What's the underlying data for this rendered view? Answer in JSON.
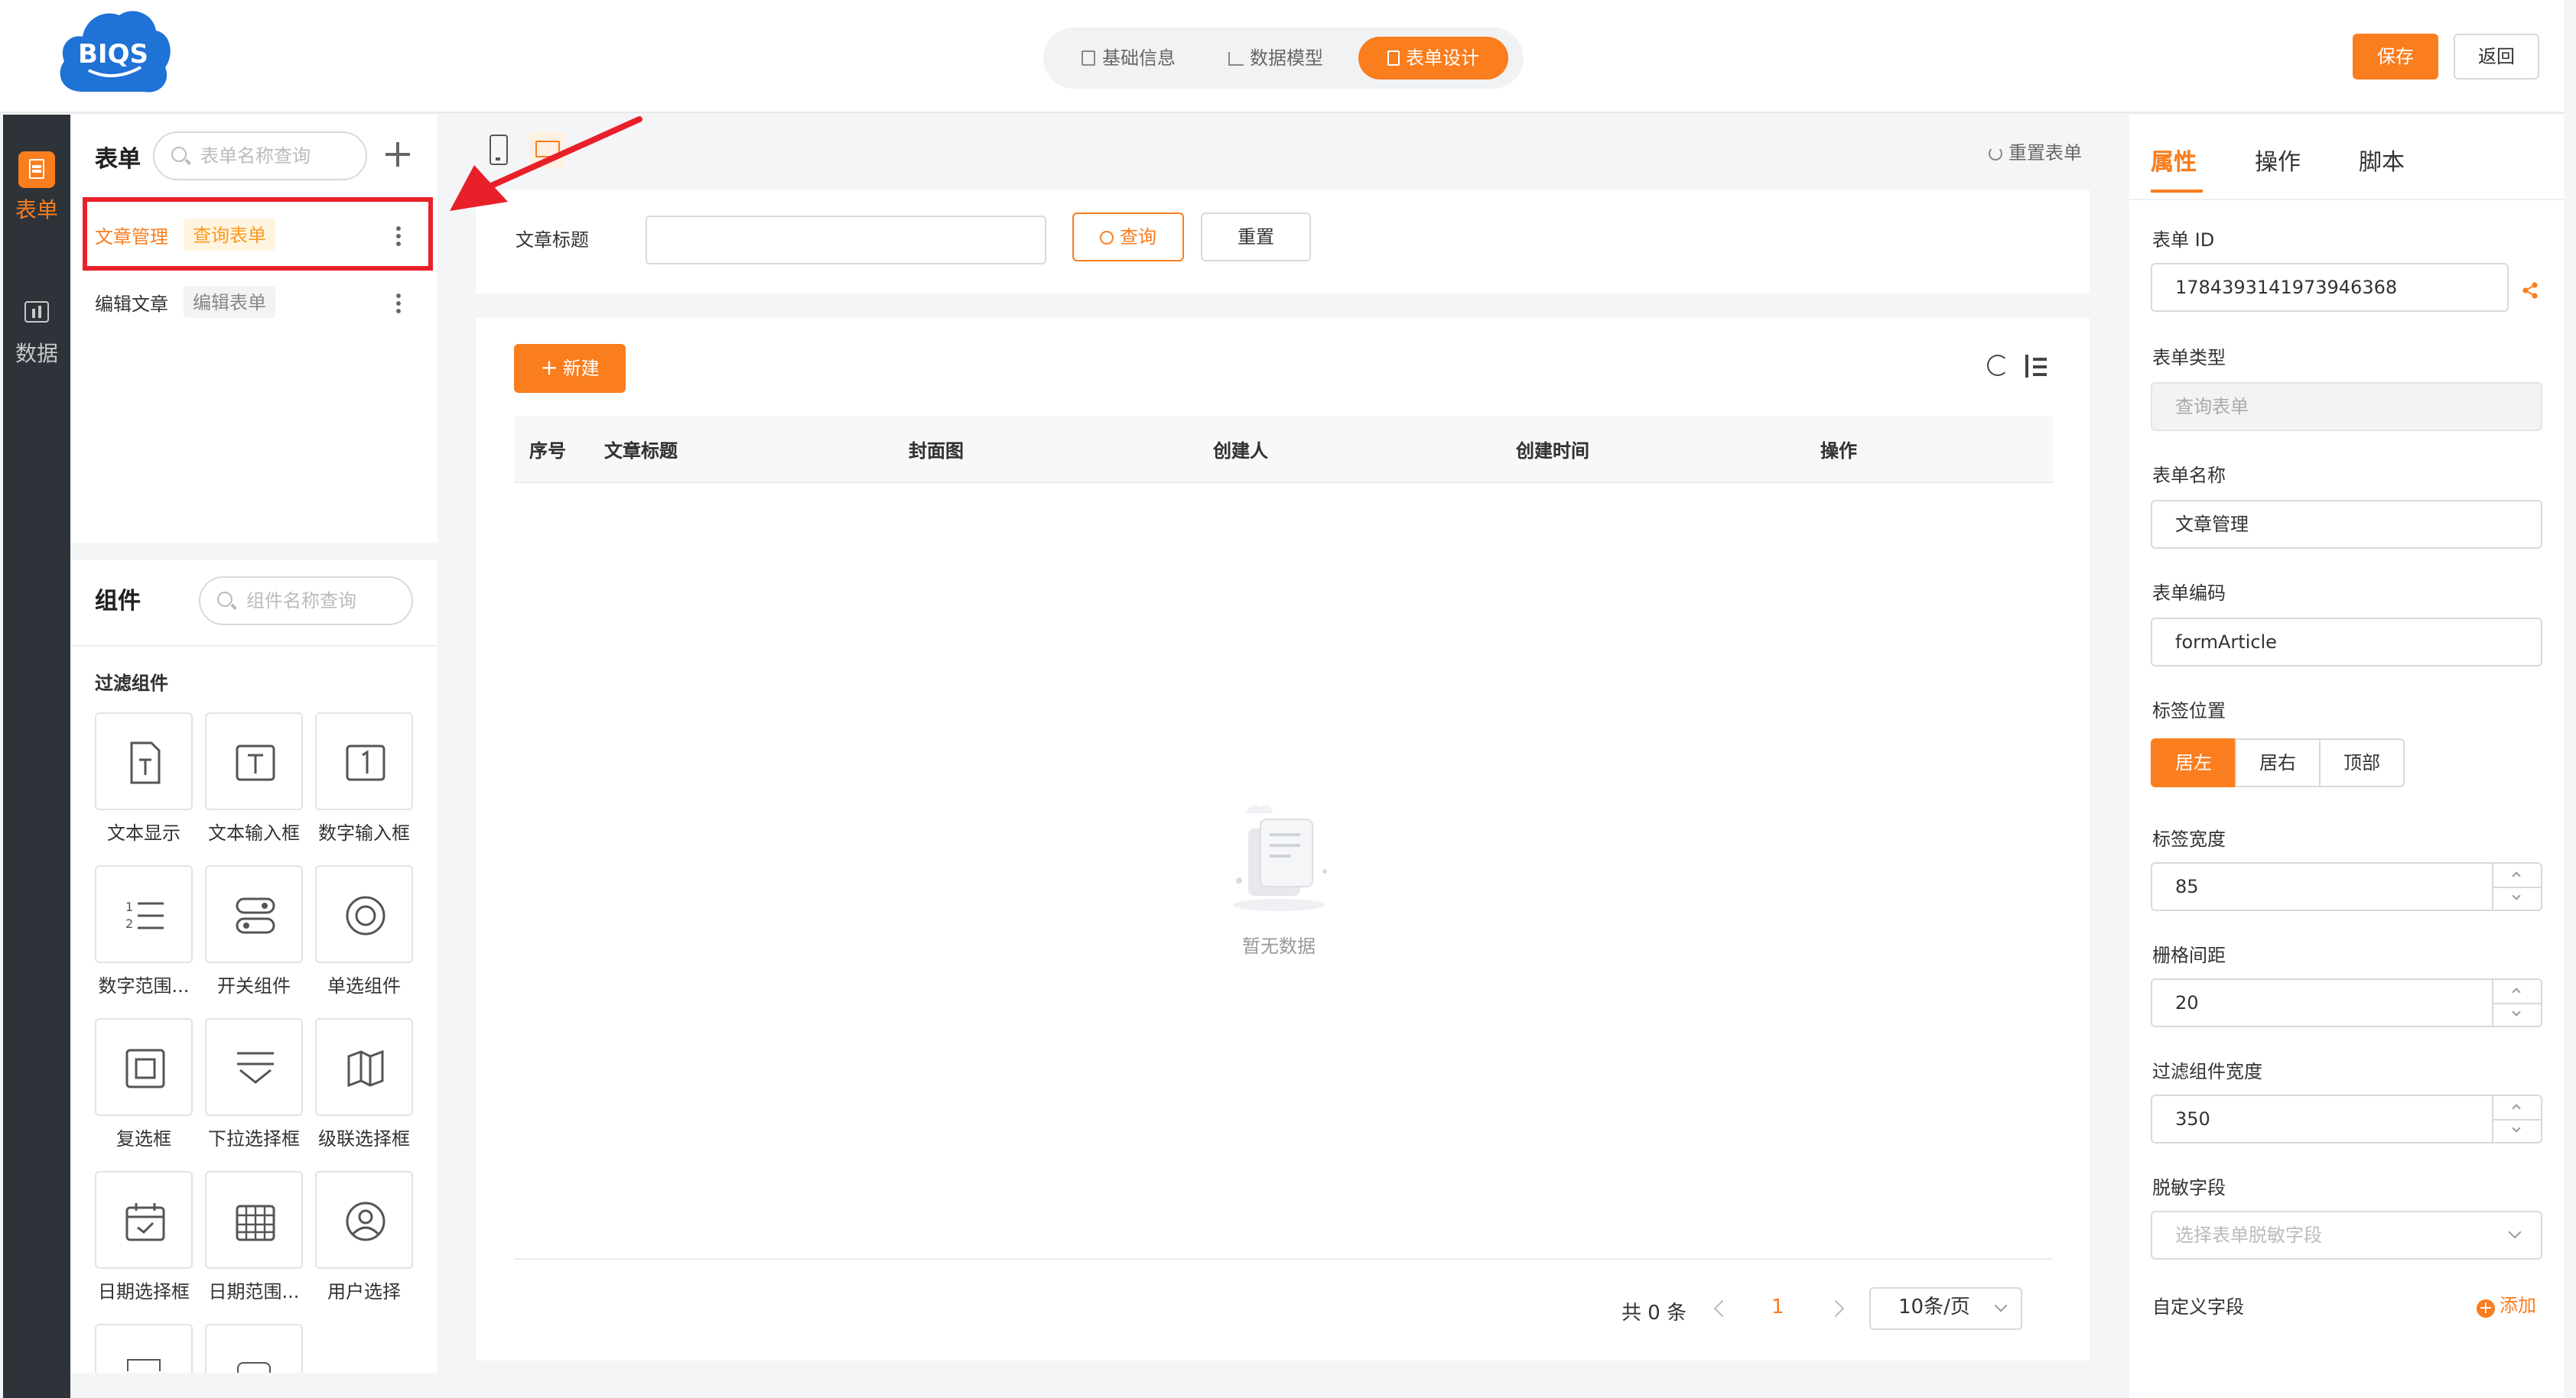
{
  "app": {
    "logo_text": "BIQS"
  },
  "header": {
    "steps": [
      {
        "label": "基础信息",
        "icon": "edit-doc-icon"
      },
      {
        "label": "数据模型",
        "icon": "bar-chart-icon"
      },
      {
        "label": "表单设计",
        "icon": "form-icon",
        "active": true
      }
    ],
    "save_label": "保存",
    "back_label": "返回"
  },
  "sidebar": {
    "items": [
      {
        "label": "表单",
        "icon": "form-icon",
        "active": true
      },
      {
        "label": "数据",
        "icon": "chart-icon"
      }
    ]
  },
  "forms_panel": {
    "title": "表单",
    "search_placeholder": "表单名称查询",
    "items": [
      {
        "name": "文章管理",
        "tag": "查询表单",
        "selected": true
      },
      {
        "name": "编辑文章",
        "tag": "编辑表单"
      }
    ]
  },
  "components_panel": {
    "title": "组件",
    "search_placeholder": "组件名称查询",
    "group_title": "过滤组件",
    "items": [
      {
        "label": "文本显示",
        "icon": "text-doc-icon"
      },
      {
        "label": "文本输入框",
        "icon": "text-input-icon"
      },
      {
        "label": "数字输入框",
        "icon": "number-input-icon"
      },
      {
        "label": "数字范围...",
        "icon": "number-list-icon"
      },
      {
        "label": "开关组件",
        "icon": "switch-icon"
      },
      {
        "label": "单选组件",
        "icon": "radio-icon"
      },
      {
        "label": "复选框",
        "icon": "checkbox-icon"
      },
      {
        "label": "下拉选择框",
        "icon": "dropdown-icon"
      },
      {
        "label": "级联选择框",
        "icon": "cascade-icon"
      },
      {
        "label": "日期选择框",
        "icon": "calendar-check-icon"
      },
      {
        "label": "日期范围...",
        "icon": "calendar-grid-icon"
      },
      {
        "label": "用户选择",
        "icon": "user-icon"
      }
    ]
  },
  "canvas": {
    "reset_form_label": "重置表单",
    "filter": {
      "field_label": "文章标题",
      "field_value": "",
      "query_label": "查询",
      "reset_label": "重置"
    },
    "new_label": "新建",
    "table": {
      "columns": [
        "序号",
        "文章标题",
        "封面图",
        "创建人",
        "创建时间",
        "操作"
      ],
      "rows": [],
      "empty_text": "暂无数据"
    },
    "pagination": {
      "total_text": "共 0 条",
      "current_page": "1",
      "page_size": "10条/页"
    }
  },
  "properties": {
    "tabs": [
      {
        "label": "属性",
        "active": true
      },
      {
        "label": "操作"
      },
      {
        "label": "脚本"
      }
    ],
    "form_id_label": "表单 ID",
    "form_id_value": "1784393141973946368",
    "form_type_label": "表单类型",
    "form_type_value": "查询表单",
    "form_name_label": "表单名称",
    "form_name_value": "文章管理",
    "form_code_label": "表单编码",
    "form_code_value": "formArticle",
    "label_position_label": "标签位置",
    "label_position_options": [
      "居左",
      "居右",
      "顶部"
    ],
    "label_position_selected": "居左",
    "label_width_label": "标签宽度",
    "label_width_value": "85",
    "grid_gap_label": "栅格间距",
    "grid_gap_value": "20",
    "filter_width_label": "过滤组件宽度",
    "filter_width_value": "350",
    "masked_fields_label": "脱敏字段",
    "masked_fields_placeholder": "选择表单脱敏字段",
    "custom_fields_label": "自定义字段",
    "add_label": "添加"
  },
  "colors": {
    "accent": "#fa7d1e",
    "annotation": "#e8202a",
    "nav_bg": "#2e3339"
  }
}
